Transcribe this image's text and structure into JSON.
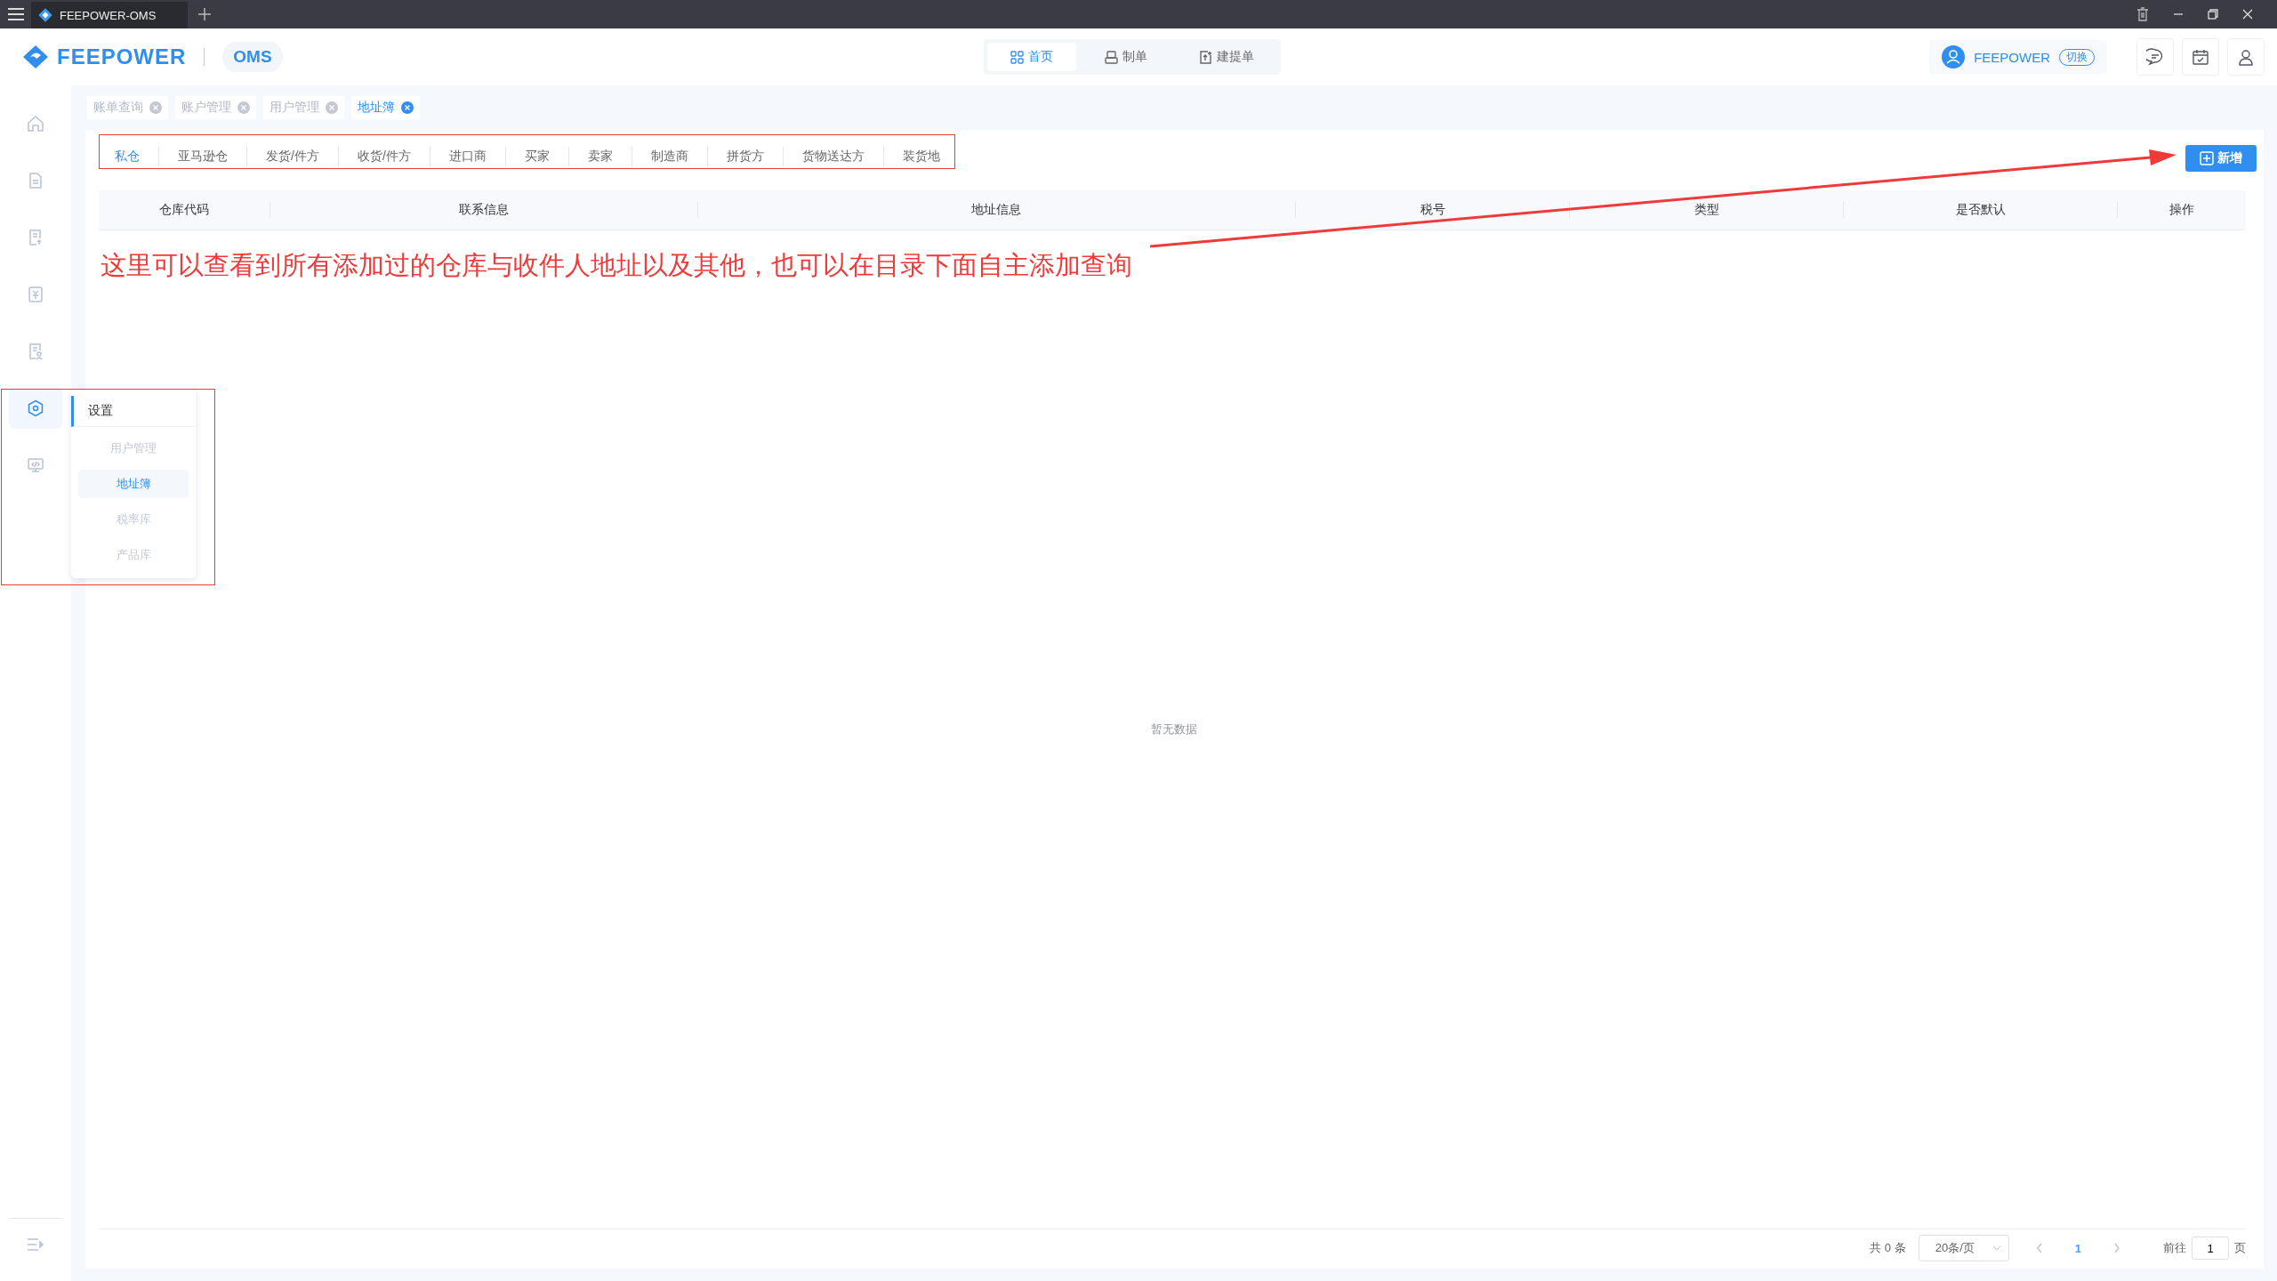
{
  "window": {
    "tab_title": "FEEPOWER-OMS"
  },
  "header": {
    "brand": "FEEPOWER",
    "product": "OMS",
    "nav": [
      {
        "label": "首页",
        "kind": "grid",
        "selected": true
      },
      {
        "label": "制单",
        "kind": "printer",
        "selected": false
      },
      {
        "label": "建提单",
        "kind": "upload",
        "selected": false
      }
    ],
    "user": "FEEPOWER",
    "switch": "切换"
  },
  "sidebar": {
    "items": [
      {
        "kind": "home",
        "selected": false
      },
      {
        "kind": "document",
        "selected": false
      },
      {
        "kind": "upload",
        "selected": false
      },
      {
        "kind": "invoice",
        "selected": false
      },
      {
        "kind": "person",
        "selected": false
      },
      {
        "kind": "settings",
        "selected": true
      },
      {
        "kind": "monitor",
        "selected": false
      }
    ]
  },
  "submenu": {
    "title": "设置",
    "items": [
      {
        "label": "用户管理",
        "selected": false
      },
      {
        "label": "地址簿",
        "selected": true
      },
      {
        "label": "税率库",
        "selected": false
      },
      {
        "label": "产品库",
        "selected": false
      }
    ]
  },
  "open_tabs": [
    {
      "label": "账单查询",
      "selected": false
    },
    {
      "label": "账户管理",
      "selected": false
    },
    {
      "label": "用户管理",
      "selected": false
    },
    {
      "label": "地址簿",
      "selected": true
    }
  ],
  "categories": [
    {
      "label": "私仓",
      "selected": true
    },
    {
      "label": "亚马逊仓",
      "selected": false
    },
    {
      "label": "发货/件方",
      "selected": false
    },
    {
      "label": "收货/件方",
      "selected": false
    },
    {
      "label": "进口商",
      "selected": false
    },
    {
      "label": "买家",
      "selected": false
    },
    {
      "label": "卖家",
      "selected": false
    },
    {
      "label": "制造商",
      "selected": false
    },
    {
      "label": "拼货方",
      "selected": false
    },
    {
      "label": "货物送达方",
      "selected": false
    },
    {
      "label": "装货地",
      "selected": false
    }
  ],
  "add_button": "新增",
  "table": {
    "columns": [
      "仓库代码",
      "联系信息",
      "地址信息",
      "税号",
      "类型",
      "是否默认",
      "操作"
    ],
    "empty_text": "暂无数据"
  },
  "annotation": "这里可以查看到所有添加过的仓库与收件人地址以及其他，也可以在目录下面自主添加查询",
  "pagination": {
    "total": "共 0 条",
    "page_size": "20条/页",
    "pages": [
      {
        "label": "1",
        "selected": true
      }
    ],
    "goto_label": "前往",
    "goto_value": "1",
    "goto_suffix": "页"
  }
}
